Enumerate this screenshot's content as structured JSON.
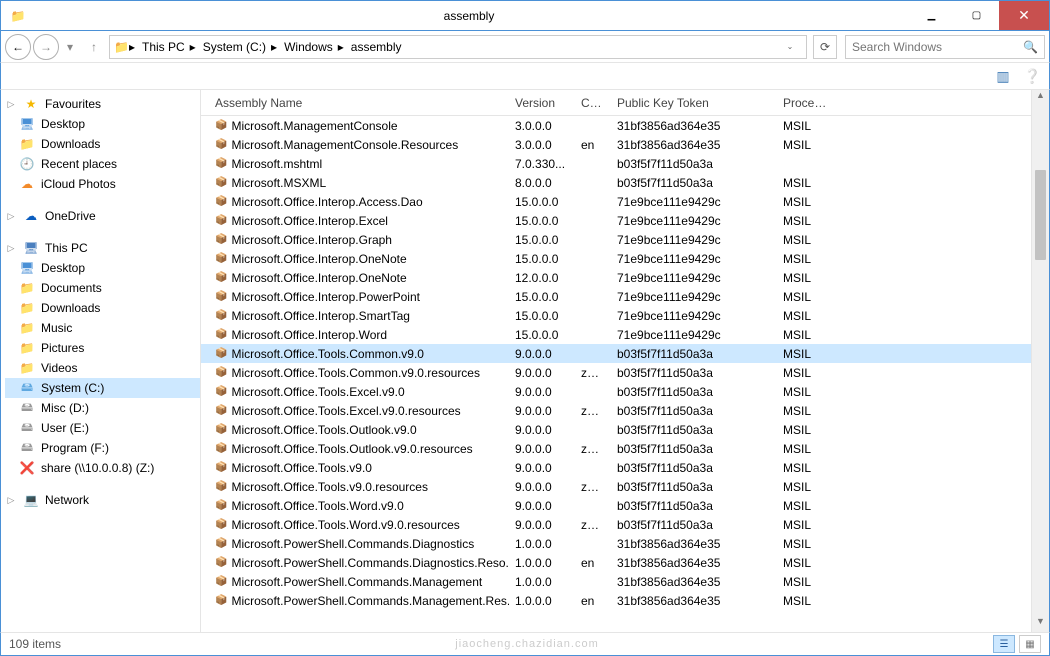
{
  "window": {
    "title": "assembly"
  },
  "address": {
    "segments": [
      "This PC",
      "System (C:)",
      "Windows",
      "assembly"
    ],
    "search_placeholder": "Search Windows"
  },
  "sidebar": {
    "favourites": {
      "label": "Favourites",
      "items": [
        {
          "label": "Desktop",
          "icon": "desktop"
        },
        {
          "label": "Downloads",
          "icon": "folder"
        },
        {
          "label": "Recent places",
          "icon": "recent"
        },
        {
          "label": "iCloud Photos",
          "icon": "cloud"
        }
      ]
    },
    "onedrive": {
      "label": "OneDrive"
    },
    "this_pc": {
      "label": "This PC",
      "items": [
        {
          "label": "Desktop",
          "icon": "desktop"
        },
        {
          "label": "Documents",
          "icon": "folder"
        },
        {
          "label": "Downloads",
          "icon": "folder"
        },
        {
          "label": "Music",
          "icon": "folder"
        },
        {
          "label": "Pictures",
          "icon": "folder"
        },
        {
          "label": "Videos",
          "icon": "folder"
        },
        {
          "label": "System (C:)",
          "icon": "sysdrive",
          "selected": true
        },
        {
          "label": "Misc (D:)",
          "icon": "drive"
        },
        {
          "label": "User (E:)",
          "icon": "drive"
        },
        {
          "label": "Program (F:)",
          "icon": "drive"
        },
        {
          "label": "share (\\\\10.0.0.8) (Z:)",
          "icon": "err"
        }
      ]
    },
    "network": {
      "label": "Network"
    }
  },
  "columns": {
    "name": "Assembly Name",
    "ver": "Version",
    "cul": "Cul...",
    "pkt": "Public Key Token",
    "proc": "Proces..."
  },
  "rows": [
    {
      "name": "Microsoft.ManagementConsole",
      "ver": "3.0.0.0",
      "cul": "",
      "pkt": "31bf3856ad364e35",
      "proc": "MSIL"
    },
    {
      "name": "Microsoft.ManagementConsole.Resources",
      "ver": "3.0.0.0",
      "cul": "en",
      "pkt": "31bf3856ad364e35",
      "proc": "MSIL"
    },
    {
      "name": "Microsoft.mshtml",
      "ver": "7.0.330...",
      "cul": "",
      "pkt": "b03f5f7f11d50a3a",
      "proc": ""
    },
    {
      "name": "Microsoft.MSXML",
      "ver": "8.0.0.0",
      "cul": "",
      "pkt": "b03f5f7f11d50a3a",
      "proc": "MSIL"
    },
    {
      "name": "Microsoft.Office.Interop.Access.Dao",
      "ver": "15.0.0.0",
      "cul": "",
      "pkt": "71e9bce111e9429c",
      "proc": "MSIL"
    },
    {
      "name": "Microsoft.Office.Interop.Excel",
      "ver": "15.0.0.0",
      "cul": "",
      "pkt": "71e9bce111e9429c",
      "proc": "MSIL"
    },
    {
      "name": "Microsoft.Office.Interop.Graph",
      "ver": "15.0.0.0",
      "cul": "",
      "pkt": "71e9bce111e9429c",
      "proc": "MSIL"
    },
    {
      "name": "Microsoft.Office.Interop.OneNote",
      "ver": "15.0.0.0",
      "cul": "",
      "pkt": "71e9bce111e9429c",
      "proc": "MSIL"
    },
    {
      "name": "Microsoft.Office.Interop.OneNote",
      "ver": "12.0.0.0",
      "cul": "",
      "pkt": "71e9bce111e9429c",
      "proc": "MSIL"
    },
    {
      "name": "Microsoft.Office.Interop.PowerPoint",
      "ver": "15.0.0.0",
      "cul": "",
      "pkt": "71e9bce111e9429c",
      "proc": "MSIL"
    },
    {
      "name": "Microsoft.Office.Interop.SmartTag",
      "ver": "15.0.0.0",
      "cul": "",
      "pkt": "71e9bce111e9429c",
      "proc": "MSIL"
    },
    {
      "name": "Microsoft.Office.Interop.Word",
      "ver": "15.0.0.0",
      "cul": "",
      "pkt": "71e9bce111e9429c",
      "proc": "MSIL",
      "underline": true
    },
    {
      "name": "Microsoft.Office.Tools.Common.v9.0",
      "ver": "9.0.0.0",
      "cul": "",
      "pkt": "b03f5f7f11d50a3a",
      "proc": "MSIL",
      "selected": true
    },
    {
      "name": "Microsoft.Office.Tools.Common.v9.0.resources",
      "ver": "9.0.0.0",
      "cul": "zh-...",
      "pkt": "b03f5f7f11d50a3a",
      "proc": "MSIL"
    },
    {
      "name": "Microsoft.Office.Tools.Excel.v9.0",
      "ver": "9.0.0.0",
      "cul": "",
      "pkt": "b03f5f7f11d50a3a",
      "proc": "MSIL"
    },
    {
      "name": "Microsoft.Office.Tools.Excel.v9.0.resources",
      "ver": "9.0.0.0",
      "cul": "zh-...",
      "pkt": "b03f5f7f11d50a3a",
      "proc": "MSIL"
    },
    {
      "name": "Microsoft.Office.Tools.Outlook.v9.0",
      "ver": "9.0.0.0",
      "cul": "",
      "pkt": "b03f5f7f11d50a3a",
      "proc": "MSIL"
    },
    {
      "name": "Microsoft.Office.Tools.Outlook.v9.0.resources",
      "ver": "9.0.0.0",
      "cul": "zh-...",
      "pkt": "b03f5f7f11d50a3a",
      "proc": "MSIL"
    },
    {
      "name": "Microsoft.Office.Tools.v9.0",
      "ver": "9.0.0.0",
      "cul": "",
      "pkt": "b03f5f7f11d50a3a",
      "proc": "MSIL"
    },
    {
      "name": "Microsoft.Office.Tools.v9.0.resources",
      "ver": "9.0.0.0",
      "cul": "zh-...",
      "pkt": "b03f5f7f11d50a3a",
      "proc": "MSIL"
    },
    {
      "name": "Microsoft.Office.Tools.Word.v9.0",
      "ver": "9.0.0.0",
      "cul": "",
      "pkt": "b03f5f7f11d50a3a",
      "proc": "MSIL"
    },
    {
      "name": "Microsoft.Office.Tools.Word.v9.0.resources",
      "ver": "9.0.0.0",
      "cul": "zh-...",
      "pkt": "b03f5f7f11d50a3a",
      "proc": "MSIL"
    },
    {
      "name": "Microsoft.PowerShell.Commands.Diagnostics",
      "ver": "1.0.0.0",
      "cul": "",
      "pkt": "31bf3856ad364e35",
      "proc": "MSIL"
    },
    {
      "name": "Microsoft.PowerShell.Commands.Diagnostics.Reso...",
      "ver": "1.0.0.0",
      "cul": "en",
      "pkt": "31bf3856ad364e35",
      "proc": "MSIL"
    },
    {
      "name": "Microsoft.PowerShell.Commands.Management",
      "ver": "1.0.0.0",
      "cul": "",
      "pkt": "31bf3856ad364e35",
      "proc": "MSIL"
    },
    {
      "name": "Microsoft.PowerShell.Commands.Management.Res...",
      "ver": "1.0.0.0",
      "cul": "en",
      "pkt": "31bf3856ad364e35",
      "proc": "MSIL"
    }
  ],
  "status": {
    "count": "109 items",
    "watermark": "jiaocheng.chazidian.com"
  }
}
